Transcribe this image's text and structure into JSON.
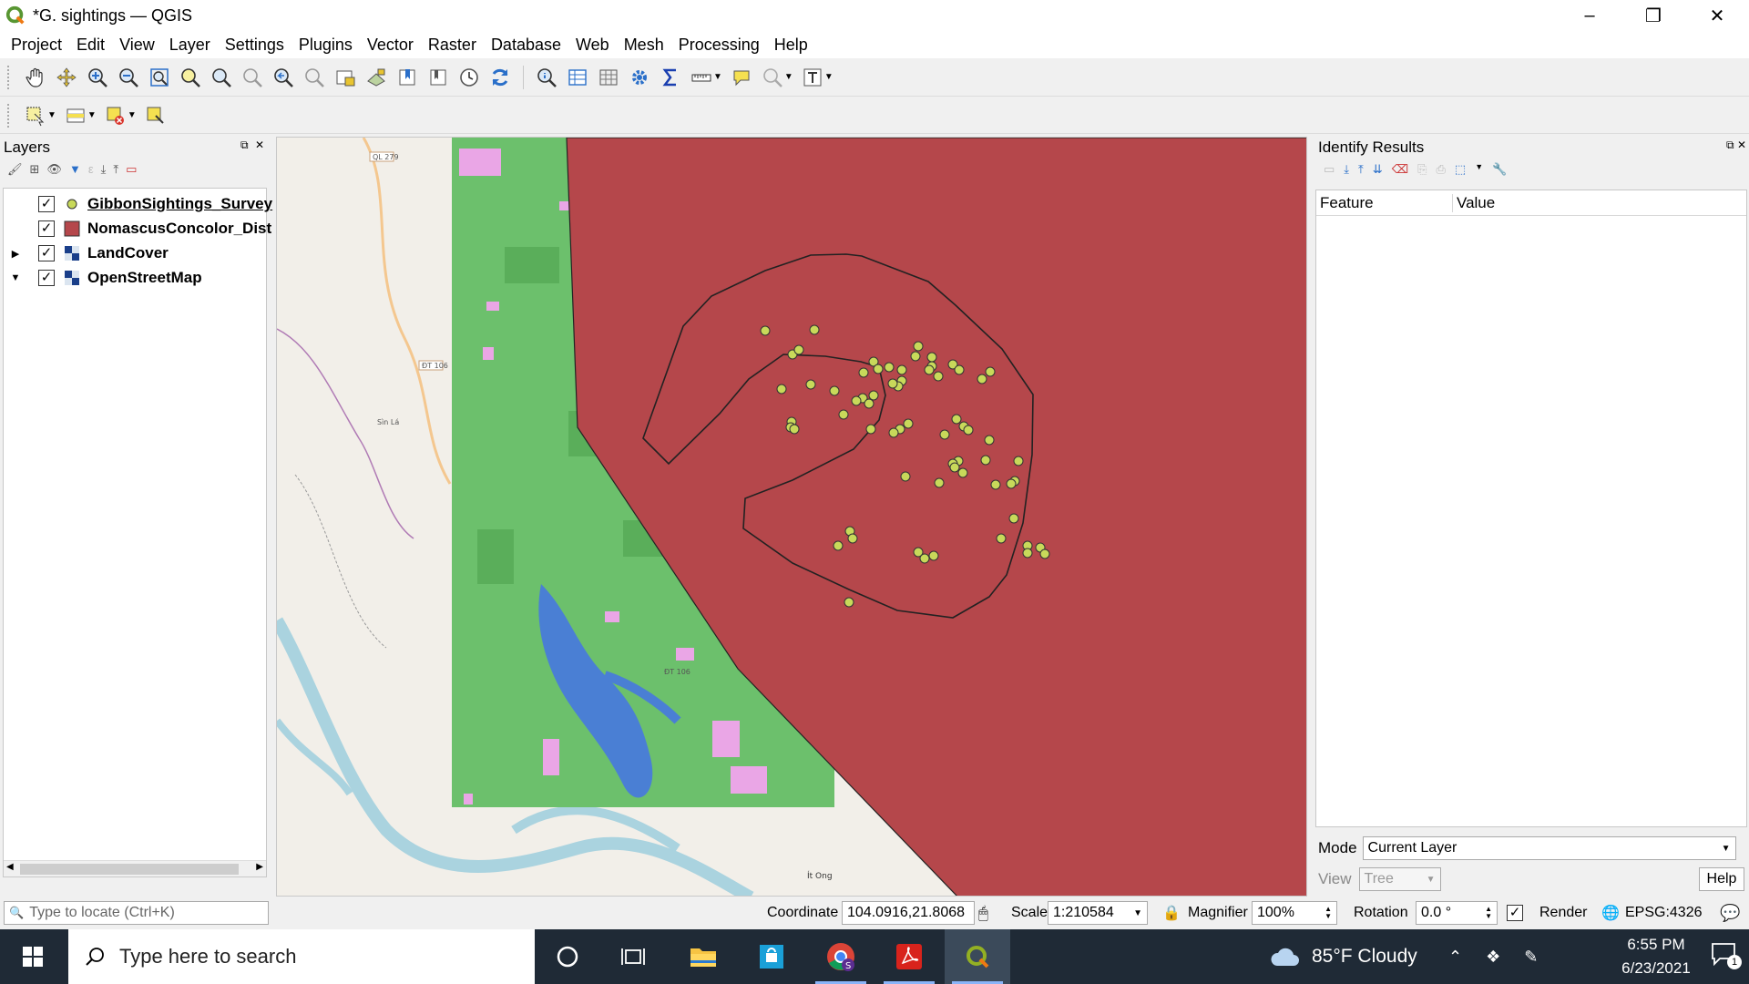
{
  "window": {
    "title": "*G. sightings — QGIS",
    "minimize_icon": "–",
    "restore_icon": "❐",
    "close_icon": "✕"
  },
  "menu": [
    "Project",
    "Edit",
    "View",
    "Layer",
    "Settings",
    "Plugins",
    "Vector",
    "Raster",
    "Database",
    "Web",
    "Mesh",
    "Processing",
    "Help"
  ],
  "layers_panel": {
    "title": "Layers",
    "layers": [
      {
        "name": "GibbonSightings_Survey",
        "checked": true,
        "symbol": "point-yellow",
        "expanded": null
      },
      {
        "name": "NomascusConcolor_Dist",
        "checked": true,
        "symbol": "polygon-red",
        "expanded": null
      },
      {
        "name": "LandCover",
        "checked": true,
        "symbol": "raster",
        "expanded": false
      },
      {
        "name": "OpenStreetMap",
        "checked": true,
        "symbol": "raster",
        "expanded": true
      }
    ],
    "locator_placeholder": "Type to locate (Ctrl+K)"
  },
  "identify_panel": {
    "title": "Identify Results",
    "columns": [
      "Feature",
      "Value"
    ],
    "mode_label": "Mode",
    "mode_value": "Current Layer",
    "view_label": "View",
    "view_value": "Tree",
    "help_button": "Help"
  },
  "map": {
    "labels": [
      "QL 279",
      "ĐT 106",
      "Sìn Lá",
      "ĐT 106",
      "Ít Ong"
    ],
    "colors": {
      "distribution": "#b5474b",
      "landcover": "#6cc06c",
      "water": "#4a7fd4",
      "points": "#c8d95a"
    }
  },
  "statusbar": {
    "coordinate_label": "Coordinate",
    "coordinate_value": "104.0916,21.8068",
    "scale_label": "Scale",
    "scale_value": "1:210584",
    "magnifier_label": "Magnifier",
    "magnifier_value": "100%",
    "rotation_label": "Rotation",
    "rotation_value": "0.0 °",
    "render_label": "Render",
    "render_checked": true,
    "crs": "EPSG:4326"
  },
  "taskbar": {
    "search_placeholder": "Type here to search",
    "weather": "85°F  Cloudy",
    "time": "6:55 PM",
    "date": "6/23/2021",
    "notification_count": "1"
  }
}
